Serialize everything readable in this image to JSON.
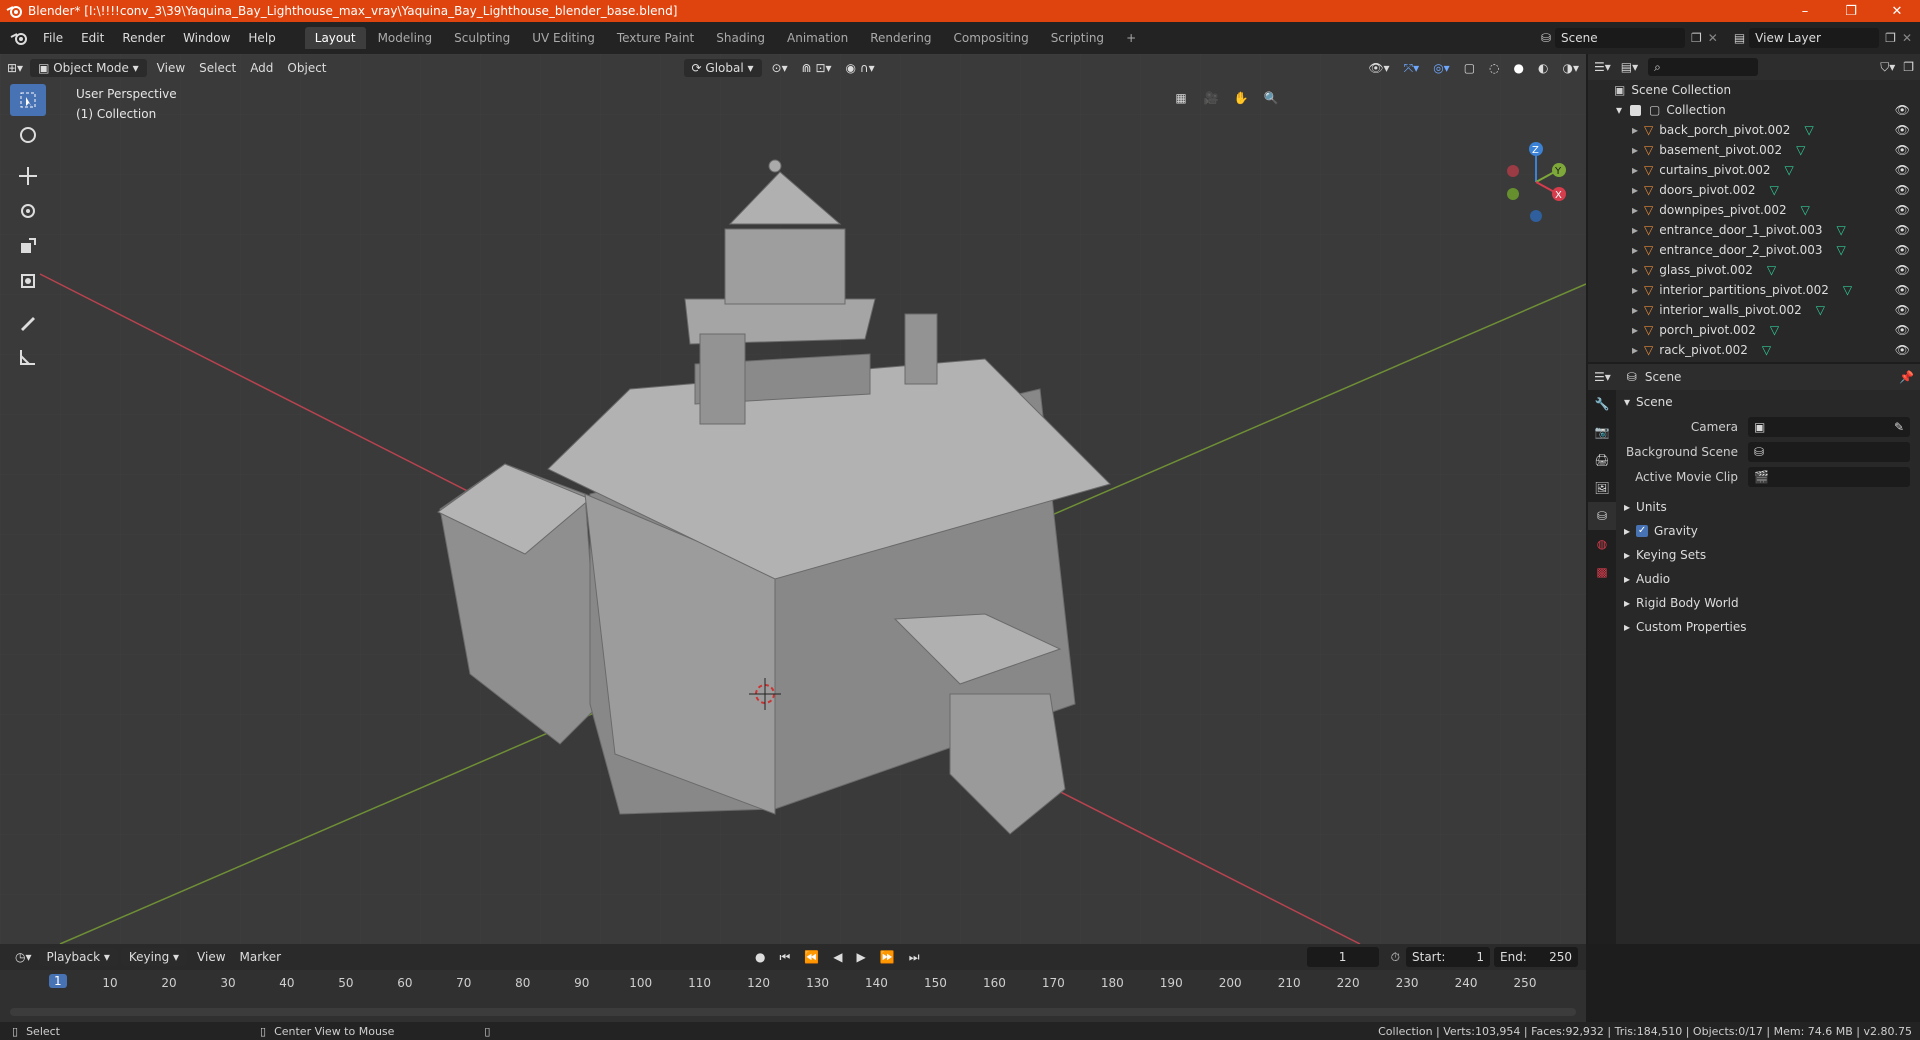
{
  "window": {
    "title": "Blender* [I:\\!!!!conv_3\\39\\Yaquina_Bay_Lighthouse_max_vray\\Yaquina_Bay_Lighthouse_blender_base.blend]",
    "minimize": "–",
    "maximize": "❐",
    "close": "✕"
  },
  "menu": [
    "File",
    "Edit",
    "Render",
    "Window",
    "Help"
  ],
  "workspaces": [
    "Layout",
    "Modeling",
    "Sculpting",
    "UV Editing",
    "Texture Paint",
    "Shading",
    "Animation",
    "Rendering",
    "Compositing",
    "Scripting"
  ],
  "active_workspace": "Layout",
  "scene_field": "Scene",
  "view_layer_field": "View Layer",
  "viewport": {
    "mode": "Object Mode",
    "menus": [
      "View",
      "Select",
      "Add",
      "Object"
    ],
    "transform_orientation": "Global",
    "info_line1": "User Perspective",
    "info_line2": "(1) Collection",
    "axis_labels": {
      "z": "Z",
      "y": "Y",
      "x": "X"
    }
  },
  "outliner": {
    "search_placeholder": "",
    "root": "Scene Collection",
    "collection": "Collection",
    "items": [
      "back_porch_pivot.002",
      "basement_pivot.002",
      "curtains_pivot.002",
      "doors_pivot.002",
      "downpipes_pivot.002",
      "entrance_door_1_pivot.003",
      "entrance_door_2_pivot.003",
      "glass_pivot.002",
      "interior_partitions_pivot.002",
      "interior_walls_pivot.002",
      "porch_pivot.002",
      "rack_pivot.002"
    ]
  },
  "properties": {
    "header": "Scene",
    "panel": "Scene",
    "camera_label": "Camera",
    "background_scene_label": "Background Scene",
    "active_movie_clip_label": "Active Movie Clip",
    "sections": [
      "Units",
      "Gravity",
      "Keying Sets",
      "Audio",
      "Rigid Body World",
      "Custom Properties"
    ],
    "gravity_checked": true
  },
  "timeline": {
    "menus": [
      "Playback",
      "Keying",
      "View",
      "Marker"
    ],
    "current_frame": "1",
    "start_label": "Start:",
    "start": "1",
    "end_label": "End:",
    "end": "250",
    "ticks": [
      "1",
      "10",
      "20",
      "30",
      "40",
      "50",
      "60",
      "70",
      "80",
      "90",
      "100",
      "110",
      "120",
      "130",
      "140",
      "150",
      "160",
      "170",
      "180",
      "190",
      "200",
      "210",
      "220",
      "230",
      "240",
      "250"
    ]
  },
  "status": {
    "select": "Select",
    "center_view": "Center View to Mouse",
    "stats": "Collection | Verts:103,954 | Faces:92,932 | Tris:184,510 | Objects:0/17 | Mem: 74.6 MB | v2.80.75"
  },
  "colors": {
    "title_bar": "#e0440e",
    "accent": "#4772b3",
    "x_axis": "#d63c4c",
    "y_axis": "#7ea83a",
    "z_axis": "#3b82d6",
    "mesh_icon": "#e38a3b",
    "filter_icon": "#2fcc9b"
  }
}
